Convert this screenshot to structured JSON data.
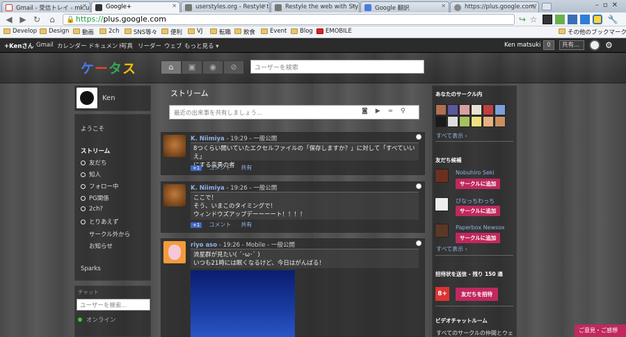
{
  "tabs": [
    {
      "title": "Gmail - 受信トレイ - mk.u",
      "icon": "gmail-icon",
      "color": "#d33"
    },
    {
      "title": "Google+",
      "icon": "google-plus-icon",
      "color": "#333"
    },
    {
      "title": "userstyles.org - Restyle t",
      "icon": "userstyles-icon",
      "color": "#666"
    },
    {
      "title": "Restyle the web with Sty",
      "icon": "userstyles-icon",
      "color": "#666"
    },
    {
      "title": "Google 翻訳",
      "icon": "google-translate-icon",
      "color": "#4a7be0"
    },
    {
      "title": "https://plus.google.com/",
      "icon": "globe-icon",
      "color": "#888"
    }
  ],
  "omnibox": {
    "scheme": "https://",
    "host": "plus.google.com"
  },
  "bookmarks": [
    "Develop",
    "Design",
    "動画",
    "2ch",
    "SNS等々",
    "便利",
    "VJ",
    "転職",
    "飲食",
    "Event",
    "Blog",
    "EMOBILE"
  ],
  "bookmarks_other": "その他のブックマーク",
  "gbar": {
    "links": [
      "+Kenさん",
      "Gmail",
      "カレンダー",
      "ドキュメント",
      "写真",
      "リーダー",
      "ウェブ",
      "もっと見る ▾"
    ],
    "user": "Ken matsuki",
    "count": "0",
    "share": "共有..."
  },
  "logo": "ケータス",
  "search_placeholder": "ユーザーを検索",
  "left": {
    "profile_name": "Ken",
    "welcome": "ようこそ",
    "stream_title": "ストリーム",
    "circles": [
      "友だち",
      "知人",
      "フォロー中",
      "PG関係",
      "2ch?",
      "とりあえず"
    ],
    "extra": [
      "サークル外から",
      "お知らせ"
    ],
    "sparks": "Sparks",
    "chat_title": "チャット",
    "chat_search_placeholder": "ユーザーを検索...",
    "online": "オンライン"
  },
  "stream": {
    "title": "ストリーム",
    "share_placeholder": "最近の出来事を共有しましょう..."
  },
  "posts": [
    {
      "name": "K. Niimiya",
      "time": "19:29",
      "visibility": "一般公開",
      "lines": [
        "8つくらい開いていたエクセルファイルの「保存しますか？」に対して「すべていいえ」",
        "にする蛮勇の者"
      ],
      "plus": "+1",
      "comment": "コメント",
      "share": "共有"
    },
    {
      "name": "K. Niimiya",
      "time": "19:26",
      "visibility": "一般公開",
      "lines": [
        "ここで！",
        "そう、いまこのタイミングで！",
        "ウィンドウズアップデーーーート！！！！"
      ],
      "plus": "+1",
      "comment": "コメント",
      "share": "共有"
    },
    {
      "name": "riyo aso",
      "time": "19:26",
      "via": "Mobile",
      "visibility": "一般公開",
      "lines": [
        "流星群が見たい( ´･ω･` )",
        "いつも21時には眠くなるけど、今日はがんばる！"
      ]
    }
  ],
  "right": {
    "circles_title": "あなたのサークル内",
    "show_all": "すべて表示 ›",
    "suggest_title": "友だち候補",
    "people": [
      "Nobuhiro Seki",
      "ぴなっちわっち",
      "Paperbox Newsox"
    ],
    "add_label": "サークルに追加",
    "show_all2": "すべて表示 ›",
    "invite_title": "招待状を送信 - 残り 150 通",
    "invite_btn": "友だちを招待",
    "video_title": "ビデオチャットルーム",
    "video_text": "すべてのサークルの仲間とウェ"
  },
  "feedback": "ご意見・ご感想"
}
